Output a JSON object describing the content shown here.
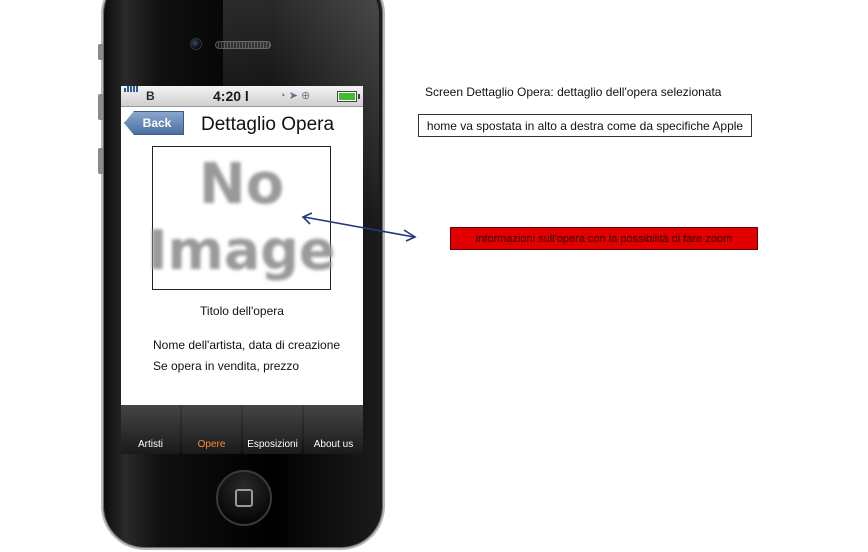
{
  "status_bar": {
    "carrier": "B",
    "time": "4:20",
    "colors": {
      "signal": "#2d5b9b",
      "battery": "#3cbf2a"
    }
  },
  "nav": {
    "back_label": "Back",
    "title": "Dettaglio Opera"
  },
  "image_placeholder": {
    "line1": "No",
    "line2": "Image"
  },
  "artwork": {
    "title": "Titolo dell'opera",
    "info_line1": "Nome dell'artista, data di creazione",
    "info_line2": "Se opera in vendita, prezzo"
  },
  "tabs": [
    {
      "label": "Artisti",
      "active": false
    },
    {
      "label": "Opere",
      "active": true
    },
    {
      "label": "Esposizioni",
      "active": false
    },
    {
      "label": "About us",
      "active": false
    }
  ],
  "annotations": {
    "screen_title": "Screen Dettaglio Opera: dettaglio dell'opera selezionata",
    "home_note": "home va spostata in alto a destra come da specifiche Apple",
    "info_note": "informazioni sull'opera con la possibilità di fare zoom"
  },
  "colors": {
    "active_tab": "#ff8a2a",
    "note_red": "#e00000",
    "arrow": "#23377a"
  }
}
